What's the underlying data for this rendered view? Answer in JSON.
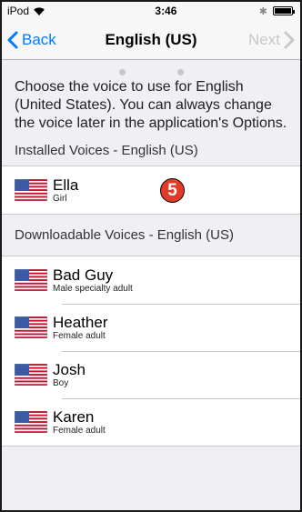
{
  "status": {
    "device": "iPod",
    "time": "3:46"
  },
  "nav": {
    "back_label": "Back",
    "title": "English (US)",
    "next_label": "Next"
  },
  "pager": {
    "total": 3,
    "current": 2
  },
  "intro_text": "Choose the voice to use for English (United States). You can always change the voice later in the application's Options.",
  "installed": {
    "header": "Installed Voices - English (US)",
    "items": [
      {
        "name": "Ella",
        "desc": "Girl"
      }
    ]
  },
  "badge": "5",
  "downloadable": {
    "header": "Downloadable Voices - English (US)",
    "items": [
      {
        "name": "Bad Guy",
        "desc": "Male specialty adult"
      },
      {
        "name": "Heather",
        "desc": "Female adult"
      },
      {
        "name": "Josh",
        "desc": "Boy"
      },
      {
        "name": "Karen",
        "desc": "Female adult"
      }
    ]
  },
  "colors": {
    "accent": "#007aff",
    "disabled": "#c7c7cc",
    "badge": "#e23b2a"
  },
  "icons": {
    "flag": "us-flag-icon",
    "back": "chevron-left-icon",
    "next": "chevron-right-icon"
  }
}
